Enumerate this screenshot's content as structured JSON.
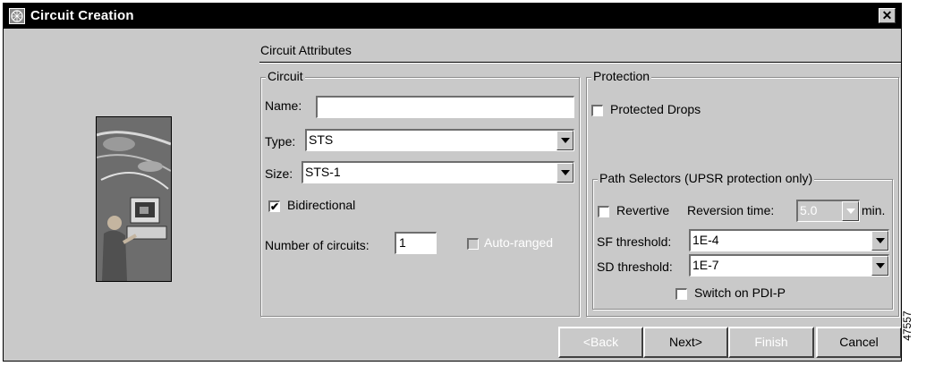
{
  "window": {
    "title": "Circuit Creation",
    "close_glyph": "✕"
  },
  "illustration": {
    "icon": "person-at-computer-network-image"
  },
  "section": {
    "title": "Circuit Attributes"
  },
  "circuit": {
    "group_title": "Circuit",
    "name_label": "Name:",
    "name_value": "",
    "type_label": "Type:",
    "type_value": "STS",
    "size_label": "Size:",
    "size_value": "STS-1",
    "bidirectional_label": "Bidirectional",
    "bidirectional_checked": true,
    "bidirectional_mark": "✔",
    "num_circuits_label": "Number of circuits:",
    "num_circuits_value": "1",
    "auto_ranged_label": "Auto-ranged"
  },
  "protection": {
    "group_title": "Protection",
    "protected_drops_label": "Protected Drops",
    "path_selectors_title": "Path Selectors (UPSR protection only)",
    "revertive_label": "Revertive",
    "reversion_time_label": "Reversion time:",
    "reversion_time_value": "5.0",
    "min_label": "min.",
    "sf_label": "SF threshold:",
    "sf_value": "1E-4",
    "sd_label": "SD threshold:",
    "sd_value": "1E-7",
    "switch_pdi_label": "Switch on PDI-P"
  },
  "buttons": {
    "back": "<Back",
    "next": "Next>",
    "finish": "Finish",
    "cancel": "Cancel"
  },
  "figure_id": "47557",
  "colors": {
    "dialog_bg": "#c9c9c9",
    "titlebar_bg": "#000000",
    "disabled_text": "#ffffff"
  }
}
